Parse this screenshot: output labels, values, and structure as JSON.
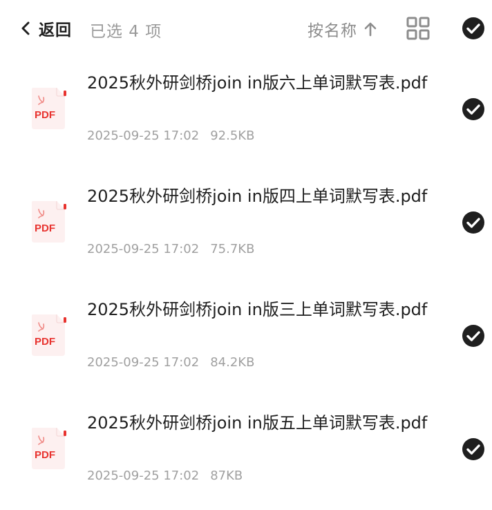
{
  "header": {
    "back_label": "返回",
    "selected_count": "已选 4 项",
    "sort_label": "按名称"
  },
  "icons": {
    "back": "chevron-left-icon",
    "sort": "arrow-up-icon",
    "grid": "grid-view-icon",
    "check": "check-circle-icon",
    "file": "pdf-file-icon"
  },
  "colors": {
    "pdf_red": "#e8332f",
    "pdf_bg": "#fdf0f0",
    "check_fill": "#1f1f1f"
  },
  "files": [
    {
      "name": "2025秋外研剑桥join in版六上单词默写表.pdf",
      "type_label": "PDF",
      "date": "2025-09-25 17:02",
      "size": "92.5KB",
      "selected": true
    },
    {
      "name": "2025秋外研剑桥join in版四上单词默写表.pdf",
      "type_label": "PDF",
      "date": "2025-09-25 17:02",
      "size": "75.7KB",
      "selected": true
    },
    {
      "name": "2025秋外研剑桥join in版三上单词默写表.pdf",
      "type_label": "PDF",
      "date": "2025-09-25 17:02",
      "size": "84.2KB",
      "selected": true
    },
    {
      "name": "2025秋外研剑桥join in版五上单词默写表.pdf",
      "type_label": "PDF",
      "date": "2025-09-25 17:02",
      "size": "87KB",
      "selected": true
    }
  ]
}
